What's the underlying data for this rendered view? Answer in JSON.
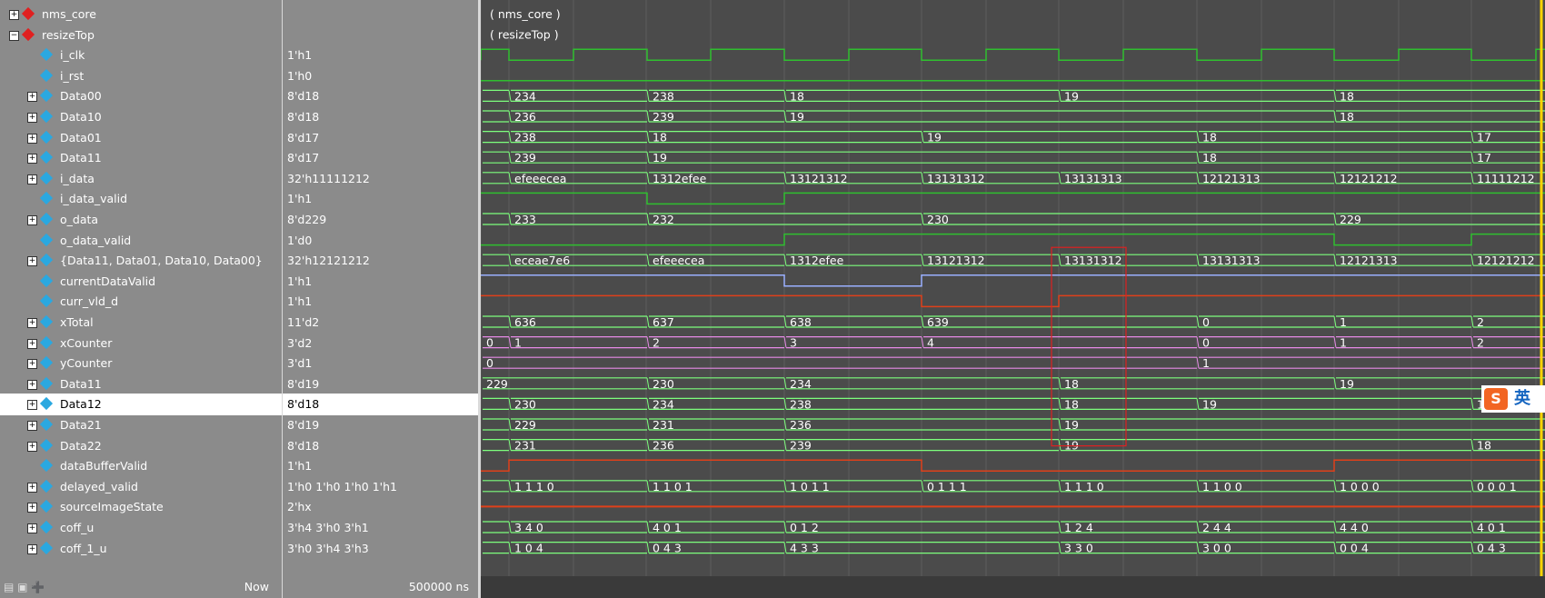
{
  "signals": [
    {
      "name": "nms_core",
      "type": "module",
      "value": "",
      "expand": "+"
    },
    {
      "name": "resizeTop",
      "type": "module",
      "value": "",
      "expand": "-"
    },
    {
      "name": "i_clk",
      "type": "in",
      "value": "1'h1",
      "expand": ""
    },
    {
      "name": "i_rst",
      "type": "in",
      "value": "1'h0",
      "expand": ""
    },
    {
      "name": "Data00",
      "type": "bus",
      "value": "8'd18",
      "expand": "+"
    },
    {
      "name": "Data10",
      "type": "bus",
      "value": "8'd18",
      "expand": "+"
    },
    {
      "name": "Data01",
      "type": "bus",
      "value": "8'd17",
      "expand": "+"
    },
    {
      "name": "Data11",
      "type": "bus",
      "value": "8'd17",
      "expand": "+"
    },
    {
      "name": "i_data",
      "type": "bus-in",
      "value": "32'h11111212",
      "expand": "+"
    },
    {
      "name": "i_data_valid",
      "type": "in",
      "value": "1'h1",
      "expand": ""
    },
    {
      "name": "o_data",
      "type": "bus-out",
      "value": "8'd229",
      "expand": "+"
    },
    {
      "name": "o_data_valid",
      "type": "out",
      "value": "1'd0",
      "expand": ""
    },
    {
      "name": "{Data11, Data01, Data10, Data00}",
      "type": "bus",
      "value": "32'h12121212",
      "expand": "+"
    },
    {
      "name": "currentDataValid",
      "type": "wire",
      "value": "1'h1",
      "expand": ""
    },
    {
      "name": "curr_vld_d",
      "type": "wire",
      "value": "1'h1",
      "expand": ""
    },
    {
      "name": "xTotal",
      "type": "bus",
      "value": "11'd2",
      "expand": "+"
    },
    {
      "name": "xCounter",
      "type": "bus",
      "value": "3'd2",
      "expand": "+"
    },
    {
      "name": "yCounter",
      "type": "bus",
      "value": "3'd1",
      "expand": "+"
    },
    {
      "name": "Data11",
      "type": "bus",
      "value": "8'd19",
      "expand": "+"
    },
    {
      "name": "Data12",
      "type": "bus",
      "value": "8'd18",
      "expand": "+",
      "selected": true
    },
    {
      "name": "Data21",
      "type": "bus",
      "value": "8'd19",
      "expand": "+"
    },
    {
      "name": "Data22",
      "type": "bus",
      "value": "8'd18",
      "expand": "+"
    },
    {
      "name": "dataBufferValid",
      "type": "wire",
      "value": "1'h1",
      "expand": ""
    },
    {
      "name": "delayed_valid",
      "type": "bus",
      "value": "1'h0 1'h0 1'h0 1'h1",
      "expand": "+"
    },
    {
      "name": "sourceImageState",
      "type": "bus",
      "value": "2'hx",
      "expand": "+"
    },
    {
      "name": "coff_u",
      "type": "bus",
      "value": "3'h4 3'h0 3'h1",
      "expand": "+"
    },
    {
      "name": "coff_1_u",
      "type": "bus",
      "value": "3'h0 3'h4 3'h3",
      "expand": "+"
    }
  ],
  "footer": {
    "now_label": "Now",
    "now_value": "500000 ns"
  },
  "waves": {
    "module_labels": [
      "( nms_core )",
      "( resizeTop )"
    ],
    "buses": {
      "4": [
        [
          "",
          0
        ],
        [
          "234",
          0
        ],
        [
          "238",
          0
        ],
        [
          "18",
          0
        ],
        [
          "19",
          0
        ],
        [
          "18",
          0
        ]
      ],
      "5": [
        [
          "",
          0
        ],
        [
          "236",
          0
        ],
        [
          "239",
          0
        ],
        [
          "19",
          0
        ],
        [
          "18",
          0
        ]
      ],
      "6": [
        [
          "",
          0
        ],
        [
          "238",
          0
        ],
        [
          "18",
          0
        ],
        [
          "19",
          0
        ],
        [
          "18",
          0
        ],
        [
          "17",
          0
        ]
      ],
      "7": [
        [
          "",
          0
        ],
        [
          "239",
          0
        ],
        [
          "19",
          0
        ],
        [
          "18",
          0
        ],
        [
          "17",
          0
        ]
      ],
      "8": [
        [
          "",
          0
        ],
        [
          "efeeecea",
          0
        ],
        [
          "1312efee",
          0
        ],
        [
          "13121312",
          0
        ],
        [
          "13131312",
          0
        ],
        [
          "13131313",
          0
        ],
        [
          "12121313",
          0
        ],
        [
          "12121212",
          0
        ],
        [
          "11111212",
          0
        ]
      ],
      "10": [
        [
          "",
          0
        ],
        [
          "233",
          0
        ],
        [
          "232",
          0
        ],
        [
          "230",
          0
        ],
        [
          "229",
          0
        ]
      ],
      "12": [
        [
          "",
          0
        ],
        [
          "eceae7e6",
          0
        ],
        [
          "efeeecea",
          0
        ],
        [
          "1312efee",
          0
        ],
        [
          "13121312",
          0
        ],
        [
          "13131312",
          0
        ],
        [
          "13131313",
          0
        ],
        [
          "12121313",
          0
        ],
        [
          "12121212",
          0
        ]
      ],
      "15": [
        [
          "",
          0
        ],
        [
          "636",
          0
        ],
        [
          "637",
          0
        ],
        [
          "638",
          0
        ],
        [
          "639",
          0
        ],
        [
          "0",
          0
        ],
        [
          "1",
          0
        ],
        [
          "2",
          0
        ]
      ],
      "16": [
        [
          "0",
          0
        ],
        [
          "1",
          0
        ],
        [
          "2",
          0
        ],
        [
          "3",
          0
        ],
        [
          "4",
          0
        ],
        [
          "0",
          0
        ],
        [
          "1",
          0
        ],
        [
          "2",
          0
        ]
      ],
      "17": [
        [
          "0",
          0
        ],
        [
          "1",
          0
        ]
      ],
      "18": [
        [
          "229",
          0
        ],
        [
          "230",
          0
        ],
        [
          "234",
          0
        ],
        [
          "18",
          0
        ],
        [
          "19",
          0
        ]
      ],
      "19": [
        [
          "",
          0
        ],
        [
          "230",
          0
        ],
        [
          "234",
          0
        ],
        [
          "238",
          0
        ],
        [
          "18",
          0
        ],
        [
          "19",
          0
        ],
        [
          "18",
          0
        ]
      ],
      "20": [
        [
          "",
          0
        ],
        [
          "229",
          0
        ],
        [
          "231",
          0
        ],
        [
          "236",
          0
        ],
        [
          "19",
          0
        ]
      ],
      "21": [
        [
          "",
          0
        ],
        [
          "231",
          0
        ],
        [
          "236",
          0
        ],
        [
          "239",
          0
        ],
        [
          "19",
          0
        ],
        [
          "18",
          0
        ]
      ],
      "23": [
        [
          "",
          0
        ],
        [
          "1 1 1 0",
          0
        ],
        [
          "1 1 0 1",
          0
        ],
        [
          "1 0 1 1",
          0
        ],
        [
          "0 1 1 1",
          0
        ],
        [
          "1 1 1 0",
          0
        ],
        [
          "1 1 0 0",
          0
        ],
        [
          "1 0 0 0",
          0
        ],
        [
          "0 0 0 1",
          0
        ]
      ],
      "25": [
        [
          "",
          0
        ],
        [
          "3 4 0",
          0
        ],
        [
          "4 0 1",
          0
        ],
        [
          "0 1 2",
          0
        ],
        [
          "1 2 4",
          0
        ],
        [
          "2 4 4",
          0
        ],
        [
          "4 4 0",
          0
        ],
        [
          "4 0 1",
          0
        ]
      ],
      "26": [
        [
          "",
          0
        ],
        [
          "1 0 4",
          0
        ],
        [
          "0 4 3",
          0
        ],
        [
          "4 3 3",
          0
        ],
        [
          "3 3 0",
          0
        ],
        [
          "3 0 0",
          0
        ],
        [
          "0 0 4",
          0
        ],
        [
          "0 4 3",
          0
        ]
      ]
    },
    "ime_label": "英",
    "ime_brand": "S"
  },
  "colors": {
    "bus": "#7dff7d",
    "bit": "#2fbf2f",
    "counter": "#e68ae6",
    "reset": "#e0401a",
    "cursor": "#ffd400",
    "highlight": "#e02020",
    "valid": "#9ab0ff"
  }
}
